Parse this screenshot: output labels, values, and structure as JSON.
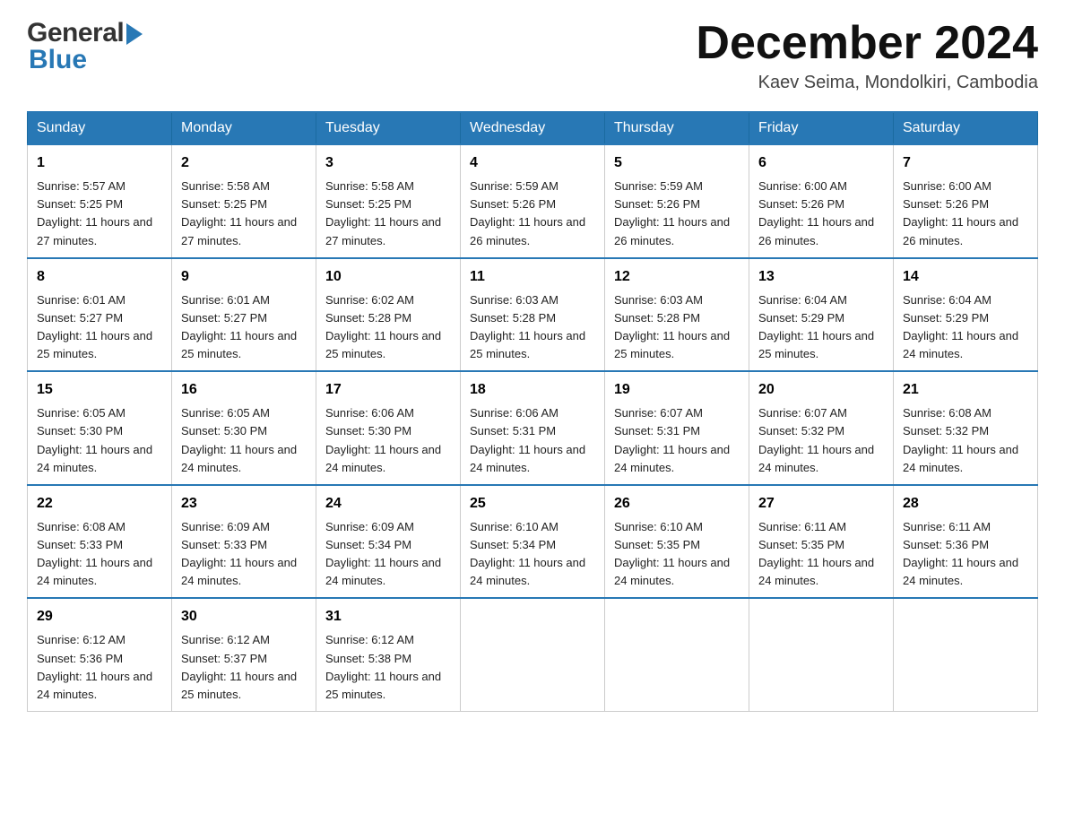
{
  "header": {
    "month_title": "December 2024",
    "location": "Kaev Seima, Mondolkiri, Cambodia",
    "logo_general": "General",
    "logo_blue": "Blue"
  },
  "weekdays": [
    "Sunday",
    "Monday",
    "Tuesday",
    "Wednesday",
    "Thursday",
    "Friday",
    "Saturday"
  ],
  "weeks": [
    [
      {
        "day": "1",
        "sunrise": "5:57 AM",
        "sunset": "5:25 PM",
        "daylight": "11 hours and 27 minutes."
      },
      {
        "day": "2",
        "sunrise": "5:58 AM",
        "sunset": "5:25 PM",
        "daylight": "11 hours and 27 minutes."
      },
      {
        "day": "3",
        "sunrise": "5:58 AM",
        "sunset": "5:25 PM",
        "daylight": "11 hours and 27 minutes."
      },
      {
        "day": "4",
        "sunrise": "5:59 AM",
        "sunset": "5:26 PM",
        "daylight": "11 hours and 26 minutes."
      },
      {
        "day": "5",
        "sunrise": "5:59 AM",
        "sunset": "5:26 PM",
        "daylight": "11 hours and 26 minutes."
      },
      {
        "day": "6",
        "sunrise": "6:00 AM",
        "sunset": "5:26 PM",
        "daylight": "11 hours and 26 minutes."
      },
      {
        "day": "7",
        "sunrise": "6:00 AM",
        "sunset": "5:26 PM",
        "daylight": "11 hours and 26 minutes."
      }
    ],
    [
      {
        "day": "8",
        "sunrise": "6:01 AM",
        "sunset": "5:27 PM",
        "daylight": "11 hours and 25 minutes."
      },
      {
        "day": "9",
        "sunrise": "6:01 AM",
        "sunset": "5:27 PM",
        "daylight": "11 hours and 25 minutes."
      },
      {
        "day": "10",
        "sunrise": "6:02 AM",
        "sunset": "5:28 PM",
        "daylight": "11 hours and 25 minutes."
      },
      {
        "day": "11",
        "sunrise": "6:03 AM",
        "sunset": "5:28 PM",
        "daylight": "11 hours and 25 minutes."
      },
      {
        "day": "12",
        "sunrise": "6:03 AM",
        "sunset": "5:28 PM",
        "daylight": "11 hours and 25 minutes."
      },
      {
        "day": "13",
        "sunrise": "6:04 AM",
        "sunset": "5:29 PM",
        "daylight": "11 hours and 25 minutes."
      },
      {
        "day": "14",
        "sunrise": "6:04 AM",
        "sunset": "5:29 PM",
        "daylight": "11 hours and 24 minutes."
      }
    ],
    [
      {
        "day": "15",
        "sunrise": "6:05 AM",
        "sunset": "5:30 PM",
        "daylight": "11 hours and 24 minutes."
      },
      {
        "day": "16",
        "sunrise": "6:05 AM",
        "sunset": "5:30 PM",
        "daylight": "11 hours and 24 minutes."
      },
      {
        "day": "17",
        "sunrise": "6:06 AM",
        "sunset": "5:30 PM",
        "daylight": "11 hours and 24 minutes."
      },
      {
        "day": "18",
        "sunrise": "6:06 AM",
        "sunset": "5:31 PM",
        "daylight": "11 hours and 24 minutes."
      },
      {
        "day": "19",
        "sunrise": "6:07 AM",
        "sunset": "5:31 PM",
        "daylight": "11 hours and 24 minutes."
      },
      {
        "day": "20",
        "sunrise": "6:07 AM",
        "sunset": "5:32 PM",
        "daylight": "11 hours and 24 minutes."
      },
      {
        "day": "21",
        "sunrise": "6:08 AM",
        "sunset": "5:32 PM",
        "daylight": "11 hours and 24 minutes."
      }
    ],
    [
      {
        "day": "22",
        "sunrise": "6:08 AM",
        "sunset": "5:33 PM",
        "daylight": "11 hours and 24 minutes."
      },
      {
        "day": "23",
        "sunrise": "6:09 AM",
        "sunset": "5:33 PM",
        "daylight": "11 hours and 24 minutes."
      },
      {
        "day": "24",
        "sunrise": "6:09 AM",
        "sunset": "5:34 PM",
        "daylight": "11 hours and 24 minutes."
      },
      {
        "day": "25",
        "sunrise": "6:10 AM",
        "sunset": "5:34 PM",
        "daylight": "11 hours and 24 minutes."
      },
      {
        "day": "26",
        "sunrise": "6:10 AM",
        "sunset": "5:35 PM",
        "daylight": "11 hours and 24 minutes."
      },
      {
        "day": "27",
        "sunrise": "6:11 AM",
        "sunset": "5:35 PM",
        "daylight": "11 hours and 24 minutes."
      },
      {
        "day": "28",
        "sunrise": "6:11 AM",
        "sunset": "5:36 PM",
        "daylight": "11 hours and 24 minutes."
      }
    ],
    [
      {
        "day": "29",
        "sunrise": "6:12 AM",
        "sunset": "5:36 PM",
        "daylight": "11 hours and 24 minutes."
      },
      {
        "day": "30",
        "sunrise": "6:12 AM",
        "sunset": "5:37 PM",
        "daylight": "11 hours and 25 minutes."
      },
      {
        "day": "31",
        "sunrise": "6:12 AM",
        "sunset": "5:38 PM",
        "daylight": "11 hours and 25 minutes."
      },
      null,
      null,
      null,
      null
    ]
  ],
  "labels": {
    "sunrise_prefix": "Sunrise: ",
    "sunset_prefix": "Sunset: ",
    "daylight_prefix": "Daylight: "
  }
}
